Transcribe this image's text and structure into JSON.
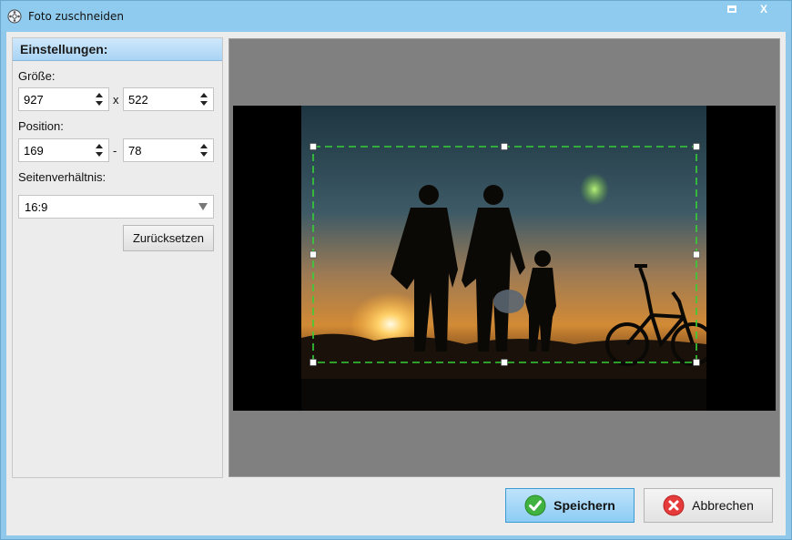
{
  "window": {
    "title": "Foto zuschneiden",
    "maximize_label": "",
    "close_label": "X"
  },
  "panel": {
    "header": "Einstellungen:",
    "size": {
      "label": "Größe:",
      "width": "927",
      "height": "522",
      "separator": "x"
    },
    "position": {
      "label": "Position:",
      "x": "169",
      "y": "78",
      "separator": "-"
    },
    "aspect": {
      "label": "Seitenverhältnis:",
      "selected": "16:9"
    },
    "reset_label": "Zurücksetzen"
  },
  "actions": {
    "save_label": "Speichern",
    "cancel_label": "Abbrechen"
  },
  "colors": {
    "titlebar": "#8fcbef",
    "crop_border": "#2fd12f",
    "save_button": "#8cccf4"
  }
}
